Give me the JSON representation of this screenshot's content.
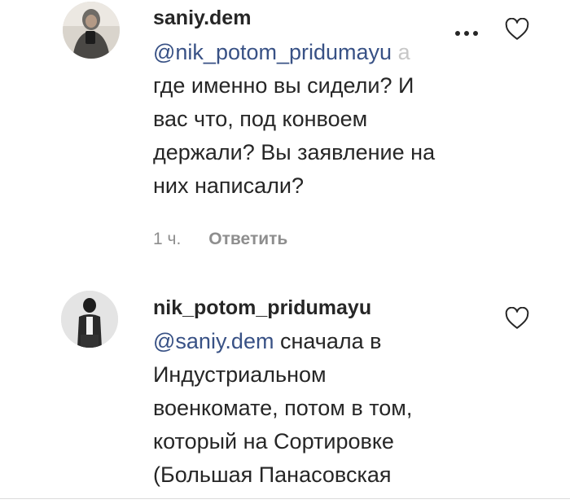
{
  "comments": [
    {
      "username": "saniy.dem",
      "mention": "@nik_potom_pridumayu",
      "mention_tail": "а",
      "text_after_mention": "где именно вы сидели? И\nвас что, под конвоем\nдержали? Вы заявление на\nних написали?",
      "time": "1 ч.",
      "reply_label": "Ответить",
      "avatar": "user-photo-hooded-phone-selfie"
    },
    {
      "username": "nik_potom_pridumayu",
      "mention": "@saniy.dem",
      "text_after_mention": " сначала в\nИндустриальном\nвоенкомате, потом в том,\nкоторый на Сортировке\n(Большая Панасовская",
      "avatar": "user-photo-dark-figure"
    }
  ],
  "colors": {
    "text": "#262626",
    "mention": "#385185",
    "meta": "#8e8e8e",
    "divider": "#dbdbdb"
  }
}
